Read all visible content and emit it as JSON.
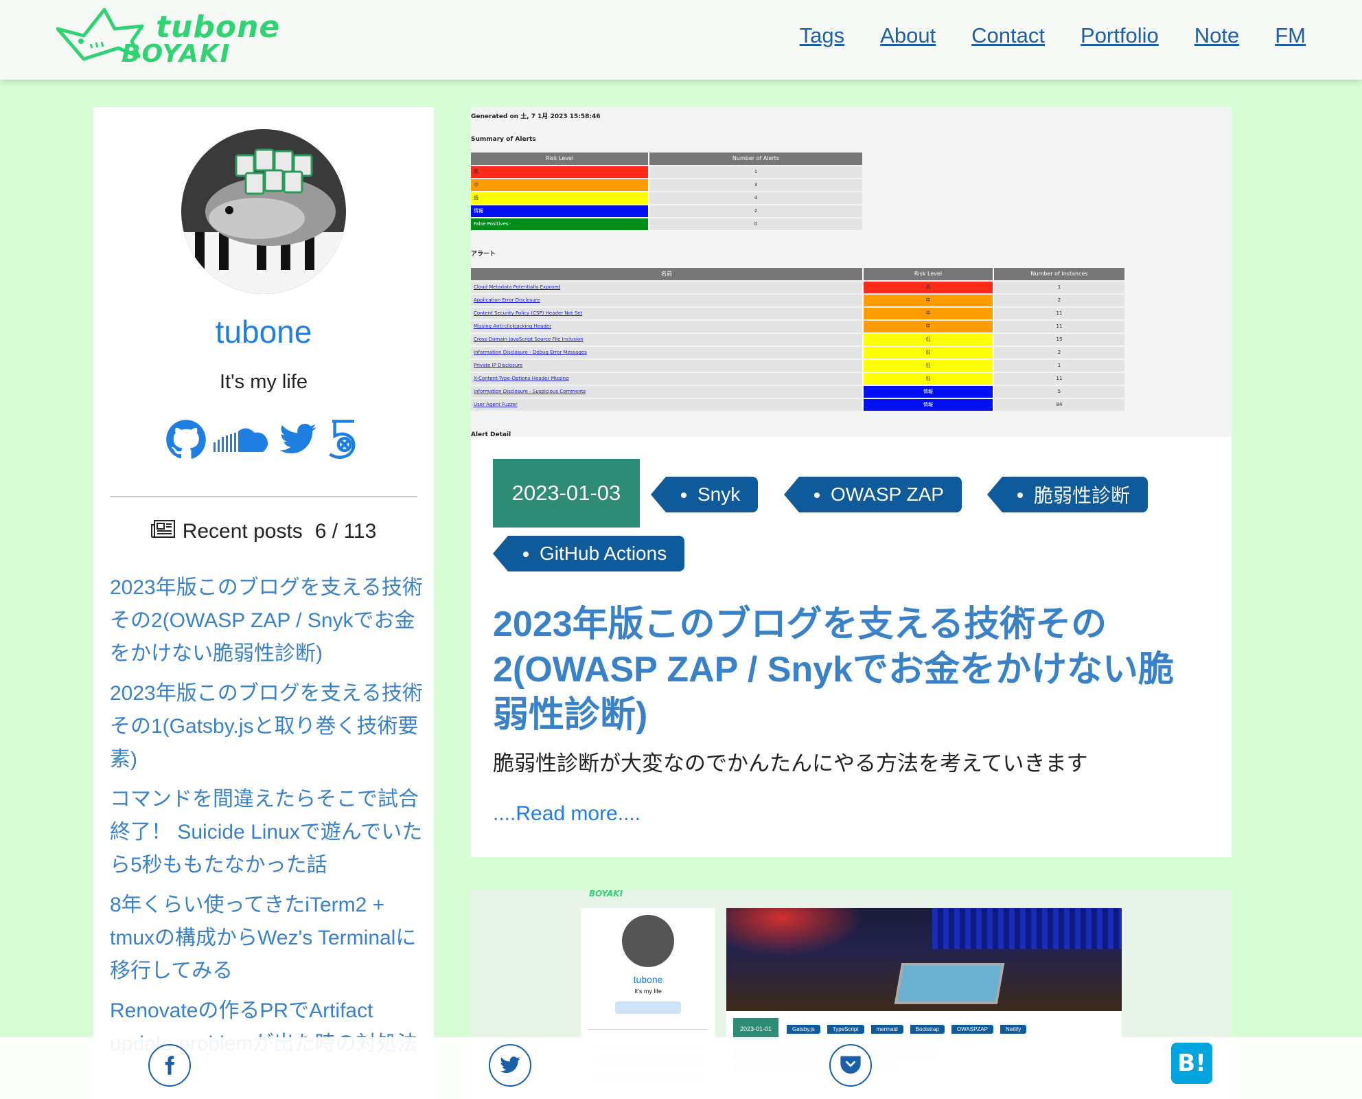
{
  "header": {
    "logo_line1": "tubone",
    "logo_line2": "BOYAKI",
    "nav": [
      "Tags",
      "About",
      "Contact",
      "Portfolio",
      "Note",
      "FM"
    ]
  },
  "sidebar": {
    "name": "tubone",
    "bio": "It's my life",
    "socials": [
      "github-icon",
      "soundcloud-icon",
      "twitter-icon",
      "html5-icon"
    ],
    "recent_label": "Recent posts",
    "recent_count": "6 / 113",
    "recent_posts": [
      "2023年版このブログを支える技術その2(OWASP ZAP / Snykでお金をかけない脆弱性診断)",
      "2023年版このブログを支える技術その1(Gatsby.jsと取り巻く技術要素)",
      "コマンドを間違えたらそこで試合終了！ Suicide Linuxで遊んでいたら5秒ももたなかった話",
      "8年くらい使ってきたiTerm2 + tmuxの構成からWez's Terminalに移行してみる",
      "Renovateの作るPRでArtifact update problemが出た時の対処法"
    ]
  },
  "post": {
    "date": "2023-01-03",
    "tags": [
      "Snyk",
      "OWASP ZAP",
      "脆弱性診断",
      "GitHub Actions"
    ],
    "title": "2023年版このブログを支える技術その2(OWASP ZAP / Snykでお金をかけない脆弱性診断)",
    "excerpt": "脆弱性診断が大変なのでかんたんにやる方法を考えていきます",
    "read_more": "....Read more....",
    "report": {
      "generated": "Generated on 土, 7 1月 2023 15:58:46",
      "summary_title": "Summary of Alerts",
      "col_risk": "Risk Level",
      "col_num": "Number of Alerts",
      "levels": [
        {
          "label": "高",
          "count": "1",
          "color": "#ff2a1a"
        },
        {
          "label": "中",
          "count": "3",
          "color": "#ff9c00"
        },
        {
          "label": "低",
          "count": "4",
          "color": "#ffff00"
        },
        {
          "label": "情報",
          "count": "2",
          "color": "#0010f5"
        },
        {
          "label": "False Positives:",
          "count": "0",
          "color": "#008c1a"
        }
      ],
      "alerts_title": "アラート",
      "col_name": "名前",
      "col_risk2": "Risk Level",
      "col_inst": "Number of Instances",
      "alerts": [
        {
          "name": "Cloud Metadata Potentially Exposed",
          "risk": "高",
          "n": "1",
          "color": "#ff2a1a"
        },
        {
          "name": "Application Error Disclosure",
          "risk": "中",
          "n": "2",
          "color": "#ff9c00"
        },
        {
          "name": "Content Security Policy (CSP) Header Not Set",
          "risk": "中",
          "n": "11",
          "color": "#ff9c00"
        },
        {
          "name": "Missing Anti-clickjacking Header",
          "risk": "中",
          "n": "11",
          "color": "#ff9c00"
        },
        {
          "name": "Cross-Domain JavaScript Source File Inclusion",
          "risk": "低",
          "n": "15",
          "color": "#ffff00"
        },
        {
          "name": "Information Disclosure - Debug Error Messages",
          "risk": "低",
          "n": "2",
          "color": "#ffff00"
        },
        {
          "name": "Private IP Disclosure",
          "risk": "低",
          "n": "1",
          "color": "#ffff00"
        },
        {
          "name": "X-Content-Type-Options Header Missing",
          "risk": "低",
          "n": "11",
          "color": "#ffff00"
        },
        {
          "name": "Information Disclosure - Suspicious Comments",
          "risk": "情報",
          "n": "5",
          "color": "#0010f5"
        },
        {
          "name": "User Agent Fuzzer",
          "risk": "情報",
          "n": "84",
          "color": "#0010f5"
        }
      ],
      "detail_title": "Alert Detail"
    }
  },
  "post2_preview": {
    "logo": "BOYAKI",
    "name": "tubone",
    "bio": "It's my life",
    "date": "2023-01-01",
    "tags": [
      "Gatsby.js",
      "TypeScript",
      "mermaid",
      "Bootstrap",
      "OWASPZAP",
      "Netlify"
    ]
  },
  "share": [
    "facebook-icon",
    "twitter-icon",
    "pocket-icon",
    "hatena-bookmark-icon"
  ],
  "share_hatena_label": "B!"
}
